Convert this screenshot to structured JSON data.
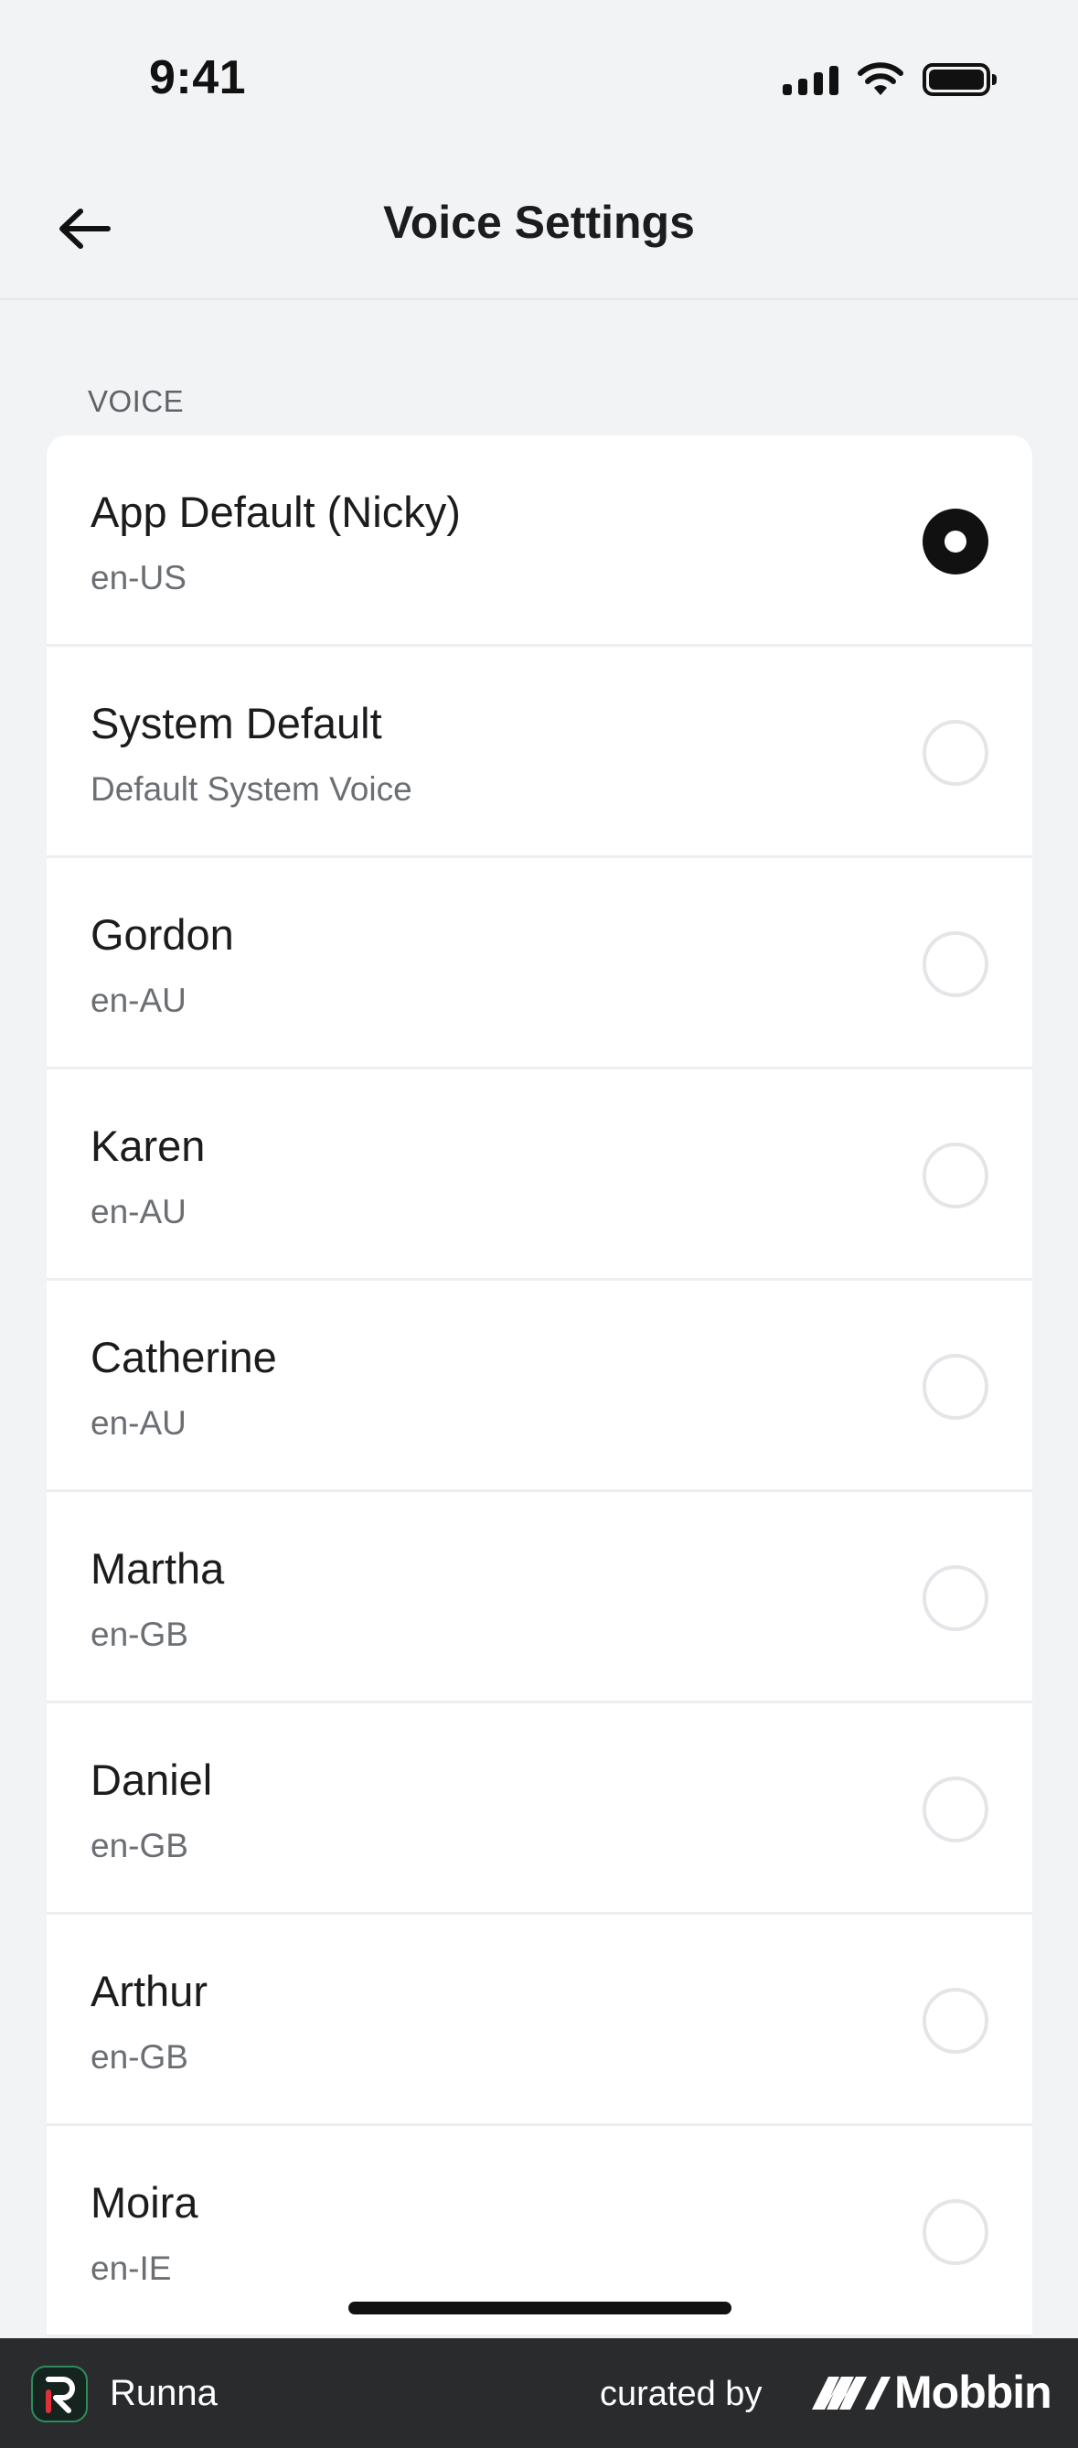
{
  "status_bar": {
    "time": "9:41"
  },
  "nav": {
    "title": "Voice Settings"
  },
  "section": {
    "header": "VOICE"
  },
  "voices": [
    {
      "name": "App Default (Nicky)",
      "subtitle": "en-US",
      "selected": true
    },
    {
      "name": "System Default",
      "subtitle": "Default System Voice",
      "selected": false
    },
    {
      "name": "Gordon",
      "subtitle": "en-AU",
      "selected": false
    },
    {
      "name": "Karen",
      "subtitle": "en-AU",
      "selected": false
    },
    {
      "name": "Catherine",
      "subtitle": "en-AU",
      "selected": false
    },
    {
      "name": "Martha",
      "subtitle": "en-GB",
      "selected": false
    },
    {
      "name": "Daniel",
      "subtitle": "en-GB",
      "selected": false
    },
    {
      "name": "Arthur",
      "subtitle": "en-GB",
      "selected": false
    },
    {
      "name": "Moira",
      "subtitle": "en-IE",
      "selected": false
    }
  ],
  "banner": {
    "app_name": "Runna",
    "curated_label": "curated by",
    "brand": "Mobbin"
  },
  "colors": {
    "background": "#f2f3f5",
    "card": "#ffffff",
    "selected_radio": "#111111",
    "banner": "#2a2b2d"
  }
}
